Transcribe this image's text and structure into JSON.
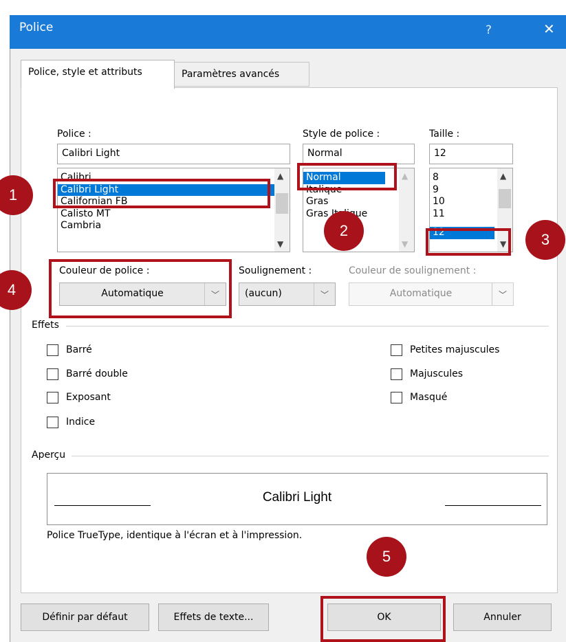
{
  "window": {
    "title": "Police",
    "help": "?",
    "close": "✕"
  },
  "tabs": [
    {
      "label": "Police, style et attributs"
    },
    {
      "label": "Paramètres avancés"
    }
  ],
  "font": {
    "label": "Police :",
    "value": "Calibri Light",
    "items": [
      "Calibri",
      "Calibri Light",
      "Californian FB",
      "Calisto MT",
      "Cambria"
    ]
  },
  "style": {
    "label": "Style de police :",
    "value": "Normal",
    "items": [
      "Normal",
      "Italique",
      "Gras",
      "Gras Italique"
    ]
  },
  "size": {
    "label": "Taille :",
    "value": "12",
    "items": [
      "8",
      "9",
      "10",
      "11",
      "12"
    ]
  },
  "color": {
    "label": "Couleur de police :",
    "value": "Automatique"
  },
  "underline": {
    "label": "Soulignement :",
    "value": "(aucun)"
  },
  "underline_color": {
    "label": "Couleur de soulignement :",
    "value": "Automatique"
  },
  "effects": {
    "title": "Effets",
    "left": [
      "Barré",
      "Barré double",
      "Exposant",
      "Indice"
    ],
    "right": [
      "Petites majuscules",
      "Majuscules",
      "Masqué"
    ]
  },
  "preview": {
    "title": "Aperçu",
    "sample": "Calibri Light",
    "note": "Police TrueType, identique à l'écran et à l'impression."
  },
  "buttons": {
    "default": "Définir par défaut",
    "effects": "Effets de texte...",
    "ok": "OK",
    "cancel": "Annuler"
  },
  "badges": [
    "1",
    "2",
    "3",
    "4",
    "5"
  ],
  "colors": {
    "titlebar": "#1a7ad8",
    "selection": "#0078d7",
    "highlight": "#b0121b",
    "badge": "#a8121a"
  }
}
